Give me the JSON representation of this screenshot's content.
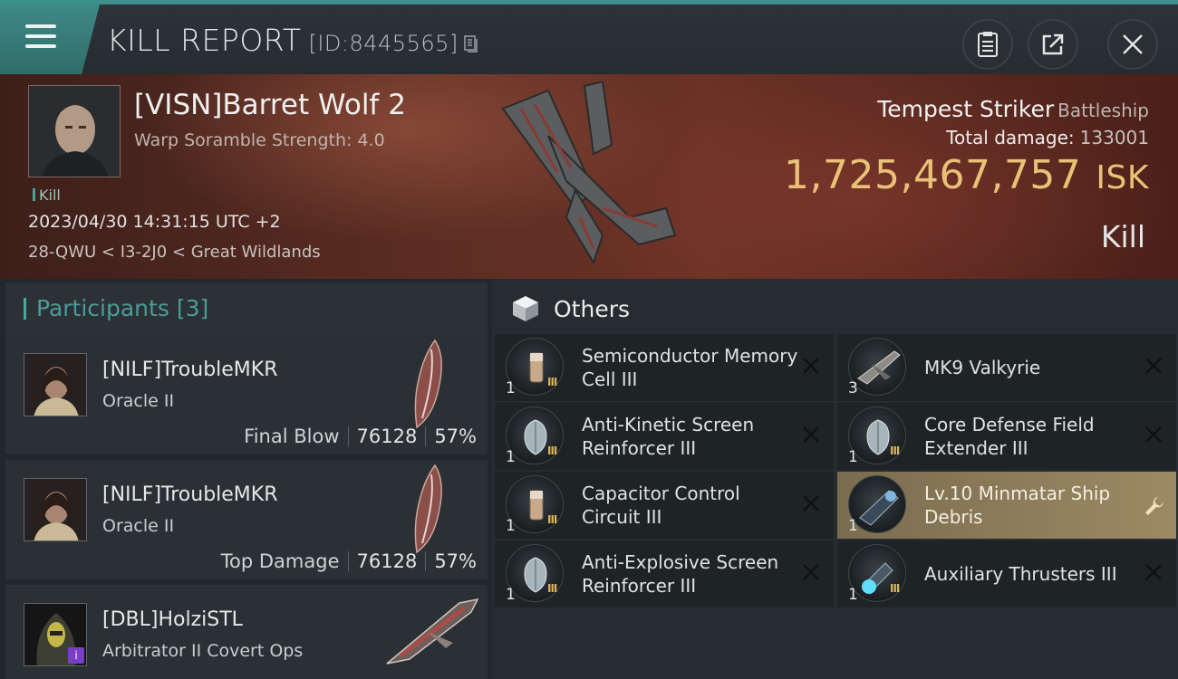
{
  "header": {
    "title": "KILL REPORT",
    "id_text": "[ID:8445565]"
  },
  "victim": {
    "name": "[VISN]Barret Wolf 2",
    "scramble": "Warp Soramble Strength: 4.0",
    "tag": "Kill",
    "time": "2023/04/30 14:31:15 UTC +2",
    "location": "28-QWU < I3-2J0 < Great Wildlands",
    "ship_name": "Tempest Striker",
    "ship_class": "Battleship",
    "total_damage_label": "Total damage:",
    "total_damage": "133001",
    "isk_value": "1,725,467,757",
    "isk_unit": "ISK",
    "result": "Kill"
  },
  "participants": {
    "label": "Participants",
    "count": "[3]",
    "rows": [
      {
        "name": "[NILF]TroubleMKR",
        "ship": "Oracle II",
        "stat_label": "Final Blow",
        "damage": "76128",
        "percent": "57%"
      },
      {
        "name": "[NILF]TroubleMKR",
        "ship": "Oracle II",
        "stat_label": "Top Damage",
        "damage": "76128",
        "percent": "57%"
      },
      {
        "name": "[DBL]HolziSTL",
        "ship": "Arbitrator II Covert Ops"
      }
    ]
  },
  "others": {
    "title": "Others",
    "items": [
      {
        "name": "Semiconductor Memory Cell III",
        "qty": "1",
        "tier": "III",
        "icon": "memory-cell-icon"
      },
      {
        "name": "MK9  Valkyrie",
        "qty": "3",
        "icon": "drone-icon"
      },
      {
        "name": "Anti-Kinetic Screen Reinforcer III",
        "qty": "1",
        "tier": "III",
        "icon": "shield-module-icon"
      },
      {
        "name": "Core Defense Field Extender III",
        "qty": "1",
        "tier": "III",
        "icon": "shield-module-icon"
      },
      {
        "name": "Capacitor Control Circuit III",
        "qty": "1",
        "tier": "III",
        "icon": "capacitor-icon"
      },
      {
        "name": "Lv.10 Minmatar Ship Debris",
        "qty": "1",
        "icon": "debris-icon"
      },
      {
        "name": "Anti-Explosive Screen Reinforcer III",
        "qty": "1",
        "tier": "III",
        "icon": "shield-module-icon"
      },
      {
        "name": "Auxiliary Thrusters III",
        "qty": "1",
        "tier": "III",
        "icon": "thruster-icon"
      }
    ]
  }
}
